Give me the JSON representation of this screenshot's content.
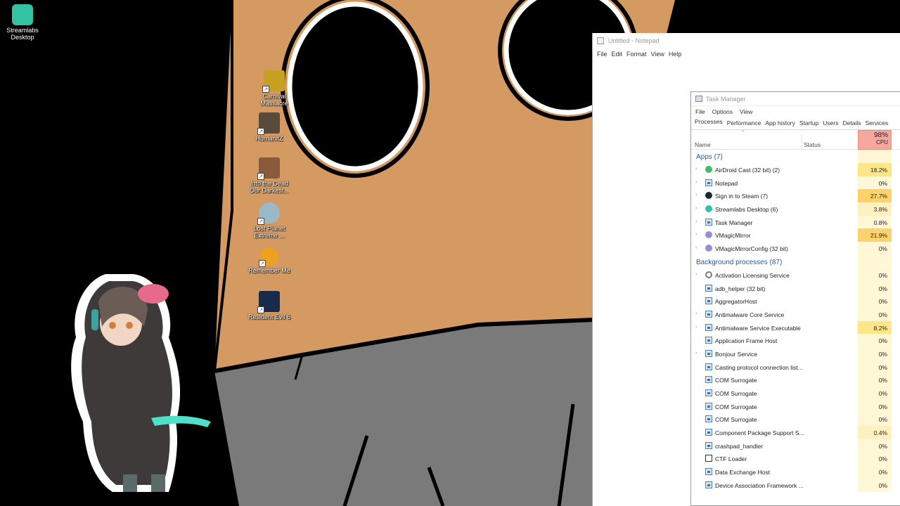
{
  "desktop": {
    "icons": [
      {
        "label": "Streamlabs Desktop",
        "icon": "streamlabs-icon",
        "color": "#31c3a2"
      },
      {
        "label": "Carnival Massacre",
        "icon": "game-shortcut-icon",
        "color": "#c8a020"
      },
      {
        "label": "HumanitZ",
        "icon": "game-shortcut-icon",
        "color": "#5a4a3a"
      },
      {
        "label": "Into the Dead Our Darkest...",
        "icon": "game-shortcut-icon",
        "color": "#8a5a3a"
      },
      {
        "label": "Lost Planet Extreme ...",
        "icon": "game-shortcut-icon",
        "color": "#9ab8c8"
      },
      {
        "label": "Remember Me",
        "icon": "game-shortcut-icon",
        "color": "#f0a020"
      },
      {
        "label": "Resident Evil 6",
        "icon": "game-shortcut-icon",
        "color": "#1a2a4a"
      }
    ]
  },
  "notepad": {
    "title": "Untitled - Notepad",
    "menu": [
      "File",
      "Edit",
      "Format",
      "View",
      "Help"
    ]
  },
  "taskmgr": {
    "title": "Task Manager",
    "menu": [
      "File",
      "Options",
      "View"
    ],
    "tabs": [
      "Processes",
      "Performance",
      "App history",
      "Startup",
      "Users",
      "Details",
      "Services"
    ],
    "active_tab": "Processes",
    "columns": {
      "name": "Name",
      "status": "Status",
      "cpu_total": "98%",
      "cpu_label": "CPU"
    },
    "apps_label": "Apps (7)",
    "apps": [
      {
        "name": "AirDroid Cast (32 bit) (2)",
        "cpu": "18.2%",
        "expandable": true,
        "icon": "airdroid-icon",
        "color": "#3dbf6c",
        "heat": "#fde68a"
      },
      {
        "name": "Notepad",
        "cpu": "0%",
        "expandable": true,
        "icon": "notepad-icon",
        "color": "#dbe7f5",
        "heat": "#fff7d6"
      },
      {
        "name": "Sign in to Steam (7)",
        "cpu": "27.7%",
        "expandable": true,
        "icon": "steam-icon",
        "color": "#1b2838",
        "heat": "#fbd36a"
      },
      {
        "name": "Streamlabs Desktop (6)",
        "cpu": "3.8%",
        "expandable": true,
        "icon": "streamlabs-icon",
        "color": "#31c3a2",
        "heat": "#fff1bf"
      },
      {
        "name": "Task Manager",
        "cpu": "0.8%",
        "expandable": true,
        "icon": "taskmgr-icon",
        "color": "#dbe7f5",
        "heat": "#fff7d6"
      },
      {
        "name": "VMagicMirror",
        "cpu": "21.9%",
        "expandable": true,
        "icon": "vmagicmirror-icon",
        "color": "#9a8ad8",
        "heat": "#fbd36a"
      },
      {
        "name": "VMagicMirrorConfig (32 bit)",
        "cpu": "0%",
        "expandable": true,
        "icon": "vmagicmirror-icon",
        "color": "#9a8ad8",
        "heat": "#fff7d6"
      }
    ],
    "bg_label": "Background processes (87)",
    "background": [
      {
        "name": "Activation Licensing Service",
        "cpu": "0%",
        "expandable": true,
        "icon": "gear-icon"
      },
      {
        "name": "adb_helper (32 bit)",
        "cpu": "0%",
        "expandable": false,
        "icon": "window-icon"
      },
      {
        "name": "AggregatorHost",
        "cpu": "0%",
        "expandable": false,
        "icon": "window-icon"
      },
      {
        "name": "Antimalware Core Service",
        "cpu": "0%",
        "expandable": true,
        "icon": "window-icon"
      },
      {
        "name": "Antimalware Service Executable",
        "cpu": "8.2%",
        "expandable": true,
        "icon": "window-icon"
      },
      {
        "name": "Application Frame Host",
        "cpu": "0%",
        "expandable": false,
        "icon": "window-icon"
      },
      {
        "name": "Bonjour Service",
        "cpu": "0%",
        "expandable": true,
        "icon": "window-icon"
      },
      {
        "name": "Casting protocol connection list...",
        "cpu": "0%",
        "expandable": false,
        "icon": "window-icon"
      },
      {
        "name": "COM Surrogate",
        "cpu": "0%",
        "expandable": false,
        "icon": "window-icon"
      },
      {
        "name": "COM Surrogate",
        "cpu": "0%",
        "expandable": false,
        "icon": "window-icon"
      },
      {
        "name": "COM Surrogate",
        "cpu": "0%",
        "expandable": false,
        "icon": "window-icon"
      },
      {
        "name": "COM Surrogate",
        "cpu": "0%",
        "expandable": false,
        "icon": "window-icon"
      },
      {
        "name": "Component Package Support S...",
        "cpu": "0.4%",
        "expandable": false,
        "icon": "window-icon"
      },
      {
        "name": "crashpad_handler",
        "cpu": "0%",
        "expandable": false,
        "icon": "window-icon"
      },
      {
        "name": "CTF Loader",
        "cpu": "0%",
        "expandable": false,
        "icon": "ctf-icon"
      },
      {
        "name": "Data Exchange Host",
        "cpu": "0%",
        "expandable": false,
        "icon": "window-icon"
      },
      {
        "name": "Device Association Framework ...",
        "cpu": "0%",
        "expandable": false,
        "icon": "window-icon"
      }
    ]
  }
}
